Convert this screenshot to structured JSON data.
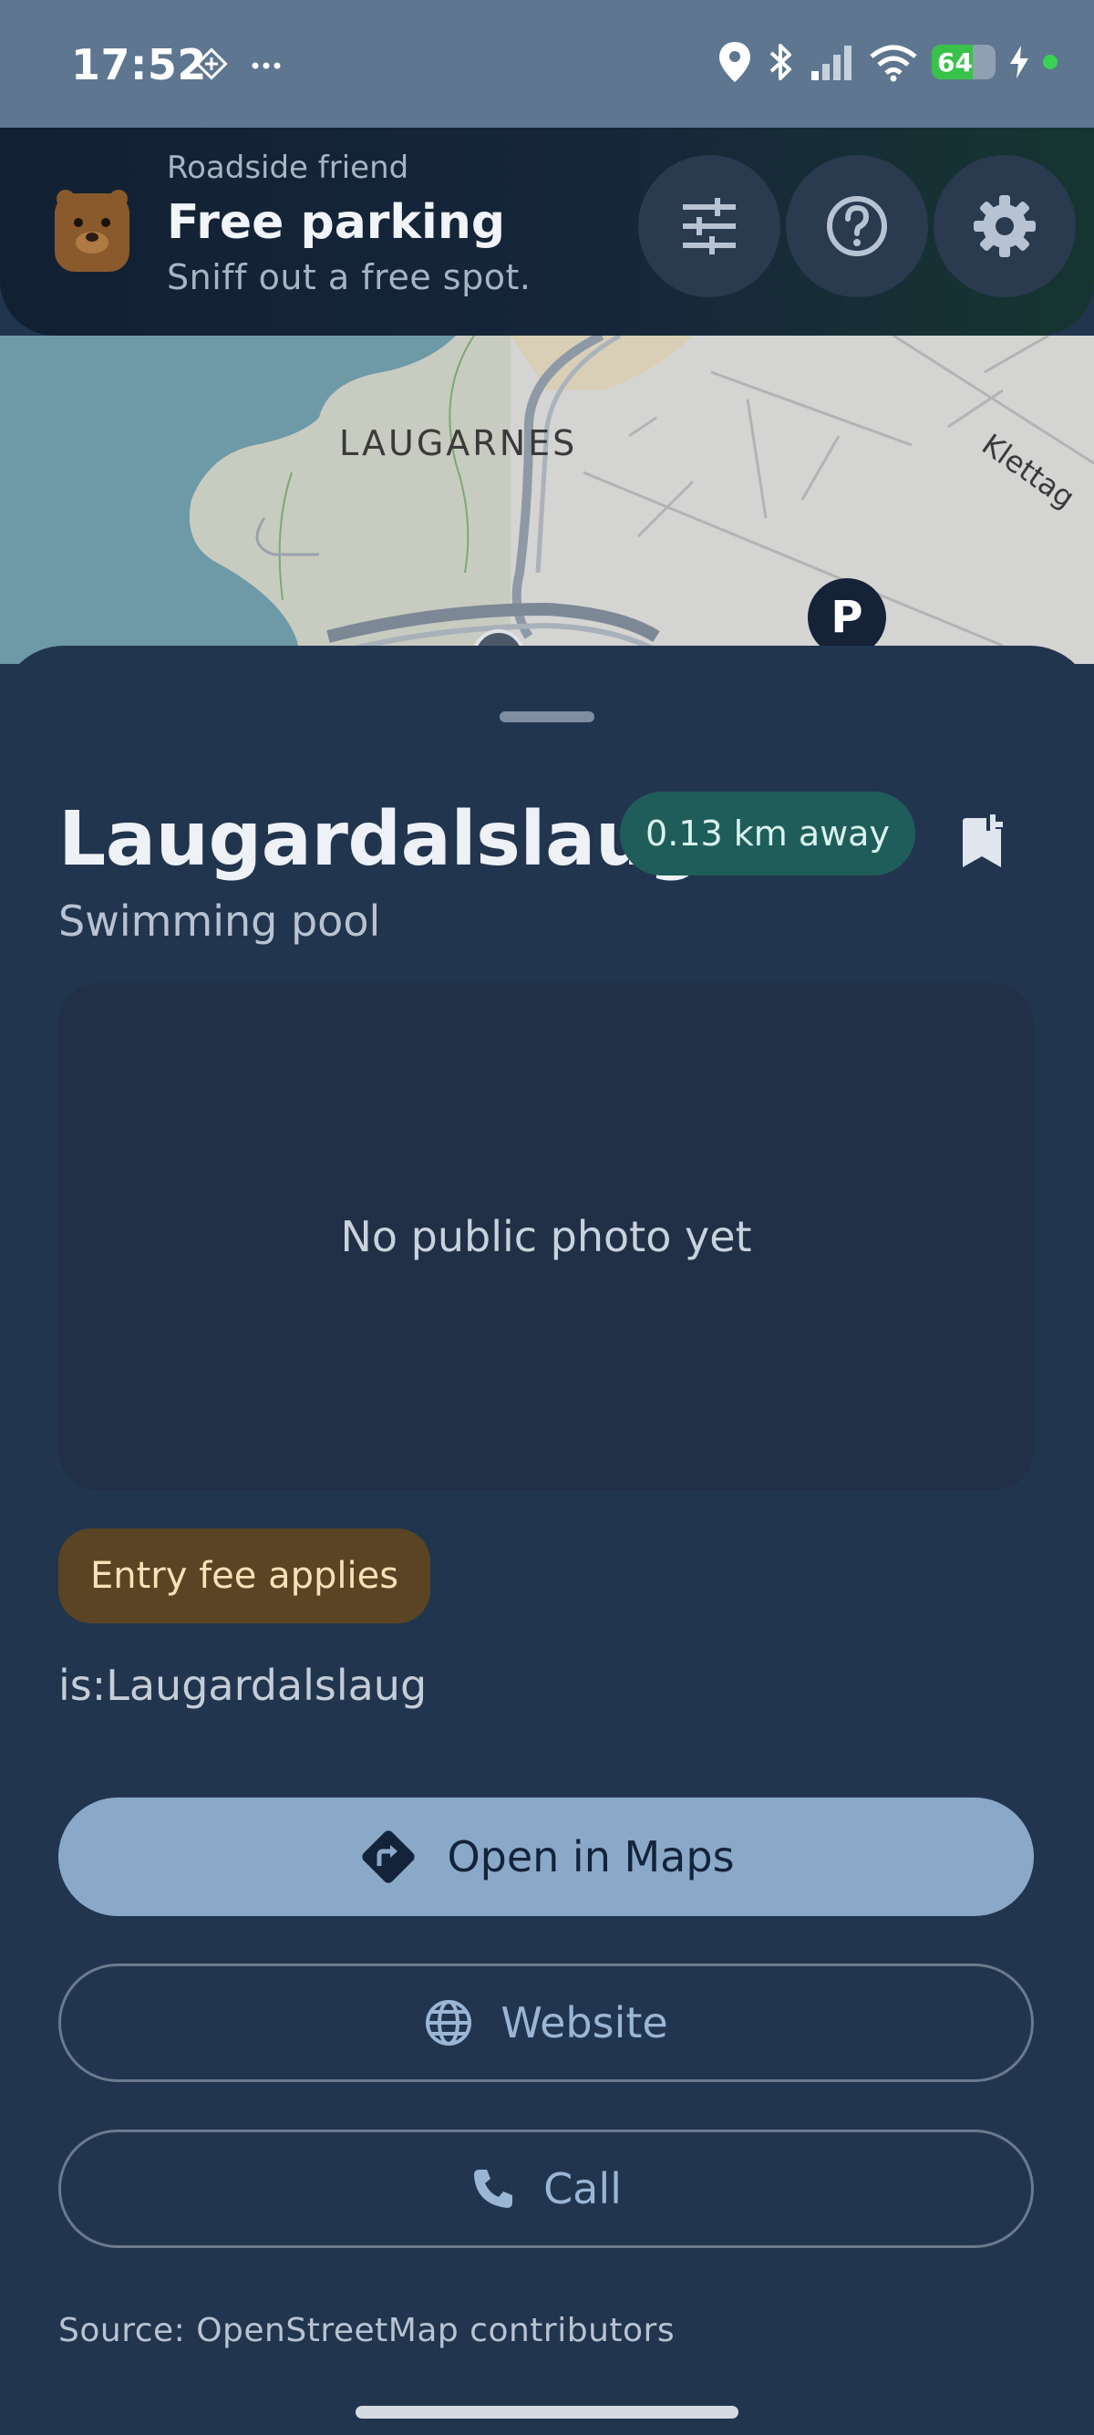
{
  "status_bar": {
    "time": "17:52",
    "battery_level": "64",
    "icons": [
      "diamond-grid-icon",
      "more-dots-icon",
      "location-pin-icon",
      "bluetooth-icon",
      "signal-icon",
      "wifi-icon",
      "battery-icon",
      "charging-bolt-icon"
    ]
  },
  "header": {
    "subtitle": "Roadside friend",
    "title": "Free parking",
    "tagline": "Sniff out a free spot.",
    "buttons": [
      "filters-icon",
      "help-icon",
      "settings-icon"
    ]
  },
  "map": {
    "labels": {
      "district": "LAUGARNES",
      "street": "Klettag"
    },
    "parking_marker": "P"
  },
  "place": {
    "name": "Laugardalslaug",
    "distance": "0.13 km away",
    "category": "Swimming pool",
    "photo_placeholder": "No public photo yet",
    "fee_badge": "Entry fee applies",
    "alt_name": "is:Laugardalslaug"
  },
  "actions": {
    "open_maps": "Open in Maps",
    "website": "Website",
    "call": "Call"
  },
  "source": "Source: OpenStreetMap contributors",
  "colors": {
    "sheet_bg": "#22354f",
    "primary_button": "#8aa9c8",
    "distance_badge": "#1f5d5a",
    "fee_badge": "#5a4423"
  }
}
